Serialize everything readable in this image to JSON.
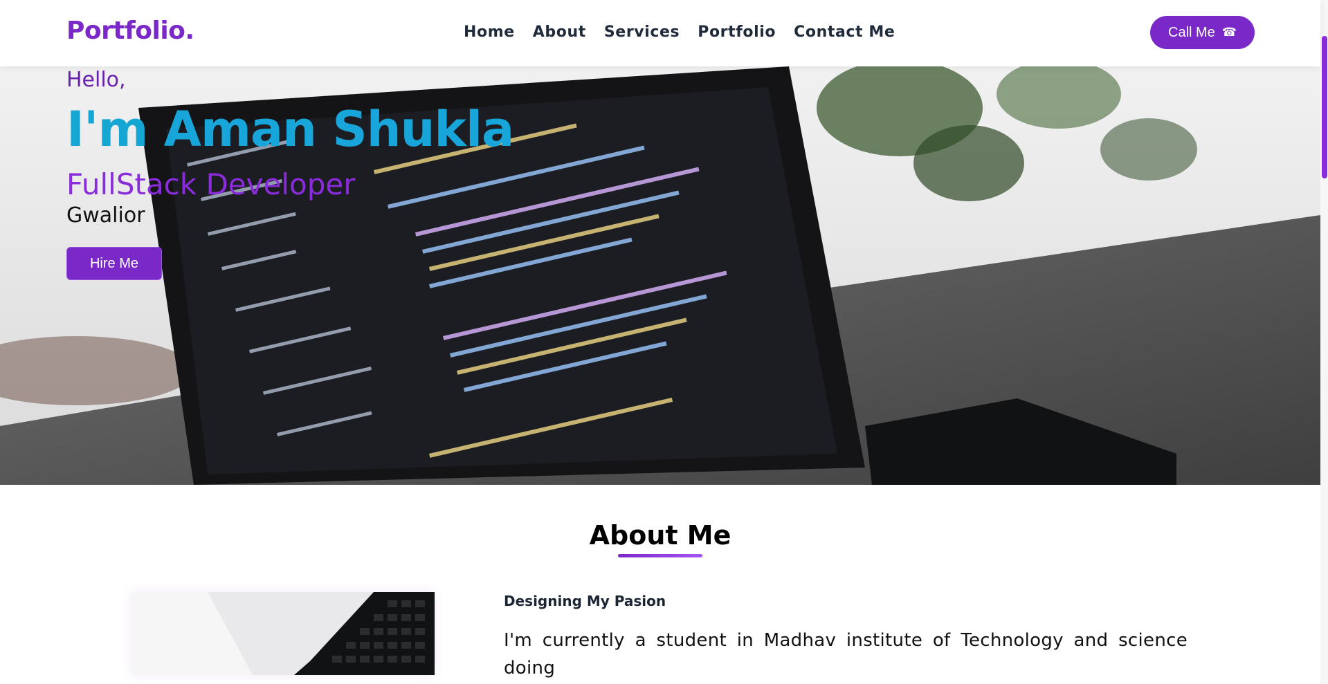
{
  "brand": {
    "logo": "Portfolio."
  },
  "nav": {
    "links": [
      "Home",
      "About",
      "Services",
      "Portfolio",
      "Contact Me"
    ],
    "call_label": "Call Me"
  },
  "hero": {
    "greeting": "Hello,",
    "name_prefix": "I'm",
    "name": "Aman Shukla",
    "role": "FullStack Developer",
    "city": "Gwalior",
    "hire_label": "Hire Me"
  },
  "about": {
    "title": "About Me",
    "subtitle": "Designing My Pasion",
    "text": "I'm currently a student in Madhav institute of Technology and science doing"
  },
  "colors": {
    "accent": "#7b28c9",
    "name_color": "#16a6d4",
    "role_color": "#8a2cdc"
  },
  "icons": [
    "phone-icon"
  ]
}
